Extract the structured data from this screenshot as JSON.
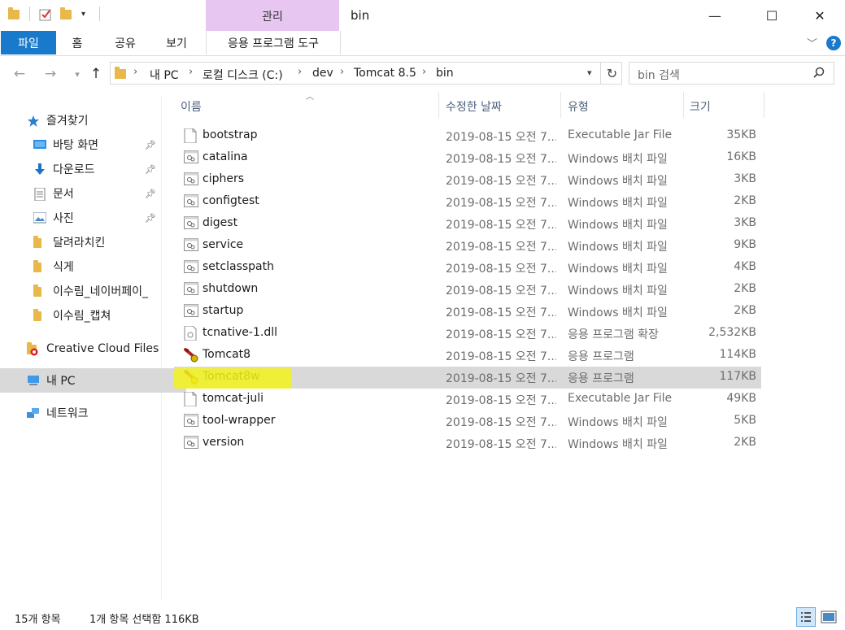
{
  "titlebar": {
    "title": "bin",
    "context_group": "관리",
    "minimize": "—",
    "maximize": "☐",
    "close": "✕"
  },
  "ribbon": {
    "tabs": [
      "파일",
      "홈",
      "공유",
      "보기",
      "응용 프로그램 도구"
    ],
    "help": "?"
  },
  "address": {
    "crumbs": [
      "내 PC",
      "로컬 디스크 (C:)",
      "dev",
      "Tomcat 8.5",
      "bin"
    ],
    "search_placeholder": "bin 검색"
  },
  "sidebar": {
    "quick_access": "즐겨찾기",
    "items": [
      {
        "label": "바탕 화면",
        "icon": "desktop-icon",
        "pinned": true
      },
      {
        "label": "다운로드",
        "icon": "download-icon",
        "pinned": true
      },
      {
        "label": "문서",
        "icon": "document-icon",
        "pinned": true
      },
      {
        "label": "사진",
        "icon": "picture-icon",
        "pinned": true
      },
      {
        "label": "달려라치킨",
        "icon": "folder-icon",
        "pinned": false
      },
      {
        "label": "식게",
        "icon": "folder-icon",
        "pinned": false
      },
      {
        "label": "이수림_네이버페이_",
        "icon": "folder-icon",
        "pinned": false
      },
      {
        "label": "이수림_캡쳐",
        "icon": "folder-icon",
        "pinned": false
      }
    ],
    "creative_cloud": "Creative Cloud Files",
    "this_pc": "내 PC",
    "network": "네트워크"
  },
  "columns": {
    "name": "이름",
    "date": "수정한 날짜",
    "type": "유형",
    "size": "크기"
  },
  "files": [
    {
      "name": "bootstrap",
      "date": "2019-08-15 오전 7...",
      "type": "Executable Jar File",
      "size": "35KB",
      "icon": "jar"
    },
    {
      "name": "catalina",
      "date": "2019-08-15 오전 7...",
      "type": "Windows 배치 파일",
      "size": "16KB",
      "icon": "bat"
    },
    {
      "name": "ciphers",
      "date": "2019-08-15 오전 7...",
      "type": "Windows 배치 파일",
      "size": "3KB",
      "icon": "bat"
    },
    {
      "name": "configtest",
      "date": "2019-08-15 오전 7...",
      "type": "Windows 배치 파일",
      "size": "2KB",
      "icon": "bat"
    },
    {
      "name": "digest",
      "date": "2019-08-15 오전 7...",
      "type": "Windows 배치 파일",
      "size": "3KB",
      "icon": "bat"
    },
    {
      "name": "service",
      "date": "2019-08-15 오전 7...",
      "type": "Windows 배치 파일",
      "size": "9KB",
      "icon": "bat"
    },
    {
      "name": "setclasspath",
      "date": "2019-08-15 오전 7...",
      "type": "Windows 배치 파일",
      "size": "4KB",
      "icon": "bat"
    },
    {
      "name": "shutdown",
      "date": "2019-08-15 오전 7...",
      "type": "Windows 배치 파일",
      "size": "2KB",
      "icon": "bat"
    },
    {
      "name": "startup",
      "date": "2019-08-15 오전 7...",
      "type": "Windows 배치 파일",
      "size": "2KB",
      "icon": "bat"
    },
    {
      "name": "tcnative-1.dll",
      "date": "2019-08-15 오전 7...",
      "type": "응용 프로그램 확장",
      "size": "2,532KB",
      "icon": "dll"
    },
    {
      "name": "Tomcat8",
      "date": "2019-08-15 오전 7...",
      "type": "응용 프로그램",
      "size": "114KB",
      "icon": "exe"
    },
    {
      "name": "Tomcat8w",
      "date": "2019-08-15 오전 7...",
      "type": "응용 프로그램",
      "size": "117KB",
      "icon": "exe",
      "selected": true
    },
    {
      "name": "tomcat-juli",
      "date": "2019-08-15 오전 7...",
      "type": "Executable Jar File",
      "size": "49KB",
      "icon": "jar"
    },
    {
      "name": "tool-wrapper",
      "date": "2019-08-15 오전 7...",
      "type": "Windows 배치 파일",
      "size": "5KB",
      "icon": "bat"
    },
    {
      "name": "version",
      "date": "2019-08-15 오전 7...",
      "type": "Windows 배치 파일",
      "size": "2KB",
      "icon": "bat"
    }
  ],
  "status": {
    "count": "15개 항목",
    "selection": "1개 항목 선택함 116KB"
  },
  "colors": {
    "accent": "#1979ca",
    "context_tab": "#e8c6f2",
    "selection": "#d9d9d9",
    "highlight": "#f2f21a"
  }
}
